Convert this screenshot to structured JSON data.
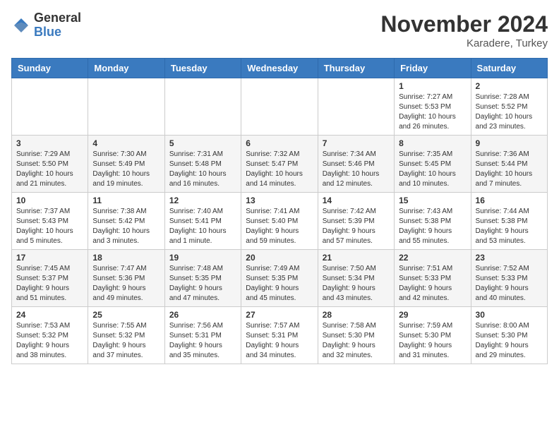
{
  "logo": {
    "general": "General",
    "blue": "Blue"
  },
  "title": "November 2024",
  "location": "Karadere, Turkey",
  "weekdays": [
    "Sunday",
    "Monday",
    "Tuesday",
    "Wednesday",
    "Thursday",
    "Friday",
    "Saturday"
  ],
  "weeks": [
    [
      {
        "day": "",
        "info": ""
      },
      {
        "day": "",
        "info": ""
      },
      {
        "day": "",
        "info": ""
      },
      {
        "day": "",
        "info": ""
      },
      {
        "day": "",
        "info": ""
      },
      {
        "day": "1",
        "info": "Sunrise: 7:27 AM\nSunset: 5:53 PM\nDaylight: 10 hours\nand 26 minutes."
      },
      {
        "day": "2",
        "info": "Sunrise: 7:28 AM\nSunset: 5:52 PM\nDaylight: 10 hours\nand 23 minutes."
      }
    ],
    [
      {
        "day": "3",
        "info": "Sunrise: 7:29 AM\nSunset: 5:50 PM\nDaylight: 10 hours\nand 21 minutes."
      },
      {
        "day": "4",
        "info": "Sunrise: 7:30 AM\nSunset: 5:49 PM\nDaylight: 10 hours\nand 19 minutes."
      },
      {
        "day": "5",
        "info": "Sunrise: 7:31 AM\nSunset: 5:48 PM\nDaylight: 10 hours\nand 16 minutes."
      },
      {
        "day": "6",
        "info": "Sunrise: 7:32 AM\nSunset: 5:47 PM\nDaylight: 10 hours\nand 14 minutes."
      },
      {
        "day": "7",
        "info": "Sunrise: 7:34 AM\nSunset: 5:46 PM\nDaylight: 10 hours\nand 12 minutes."
      },
      {
        "day": "8",
        "info": "Sunrise: 7:35 AM\nSunset: 5:45 PM\nDaylight: 10 hours\nand 10 minutes."
      },
      {
        "day": "9",
        "info": "Sunrise: 7:36 AM\nSunset: 5:44 PM\nDaylight: 10 hours\nand 7 minutes."
      }
    ],
    [
      {
        "day": "10",
        "info": "Sunrise: 7:37 AM\nSunset: 5:43 PM\nDaylight: 10 hours\nand 5 minutes."
      },
      {
        "day": "11",
        "info": "Sunrise: 7:38 AM\nSunset: 5:42 PM\nDaylight: 10 hours\nand 3 minutes."
      },
      {
        "day": "12",
        "info": "Sunrise: 7:40 AM\nSunset: 5:41 PM\nDaylight: 10 hours\nand 1 minute."
      },
      {
        "day": "13",
        "info": "Sunrise: 7:41 AM\nSunset: 5:40 PM\nDaylight: 9 hours\nand 59 minutes."
      },
      {
        "day": "14",
        "info": "Sunrise: 7:42 AM\nSunset: 5:39 PM\nDaylight: 9 hours\nand 57 minutes."
      },
      {
        "day": "15",
        "info": "Sunrise: 7:43 AM\nSunset: 5:38 PM\nDaylight: 9 hours\nand 55 minutes."
      },
      {
        "day": "16",
        "info": "Sunrise: 7:44 AM\nSunset: 5:38 PM\nDaylight: 9 hours\nand 53 minutes."
      }
    ],
    [
      {
        "day": "17",
        "info": "Sunrise: 7:45 AM\nSunset: 5:37 PM\nDaylight: 9 hours\nand 51 minutes."
      },
      {
        "day": "18",
        "info": "Sunrise: 7:47 AM\nSunset: 5:36 PM\nDaylight: 9 hours\nand 49 minutes."
      },
      {
        "day": "19",
        "info": "Sunrise: 7:48 AM\nSunset: 5:35 PM\nDaylight: 9 hours\nand 47 minutes."
      },
      {
        "day": "20",
        "info": "Sunrise: 7:49 AM\nSunset: 5:35 PM\nDaylight: 9 hours\nand 45 minutes."
      },
      {
        "day": "21",
        "info": "Sunrise: 7:50 AM\nSunset: 5:34 PM\nDaylight: 9 hours\nand 43 minutes."
      },
      {
        "day": "22",
        "info": "Sunrise: 7:51 AM\nSunset: 5:33 PM\nDaylight: 9 hours\nand 42 minutes."
      },
      {
        "day": "23",
        "info": "Sunrise: 7:52 AM\nSunset: 5:33 PM\nDaylight: 9 hours\nand 40 minutes."
      }
    ],
    [
      {
        "day": "24",
        "info": "Sunrise: 7:53 AM\nSunset: 5:32 PM\nDaylight: 9 hours\nand 38 minutes."
      },
      {
        "day": "25",
        "info": "Sunrise: 7:55 AM\nSunset: 5:32 PM\nDaylight: 9 hours\nand 37 minutes."
      },
      {
        "day": "26",
        "info": "Sunrise: 7:56 AM\nSunset: 5:31 PM\nDaylight: 9 hours\nand 35 minutes."
      },
      {
        "day": "27",
        "info": "Sunrise: 7:57 AM\nSunset: 5:31 PM\nDaylight: 9 hours\nand 34 minutes."
      },
      {
        "day": "28",
        "info": "Sunrise: 7:58 AM\nSunset: 5:30 PM\nDaylight: 9 hours\nand 32 minutes."
      },
      {
        "day": "29",
        "info": "Sunrise: 7:59 AM\nSunset: 5:30 PM\nDaylight: 9 hours\nand 31 minutes."
      },
      {
        "day": "30",
        "info": "Sunrise: 8:00 AM\nSunset: 5:30 PM\nDaylight: 9 hours\nand 29 minutes."
      }
    ]
  ]
}
